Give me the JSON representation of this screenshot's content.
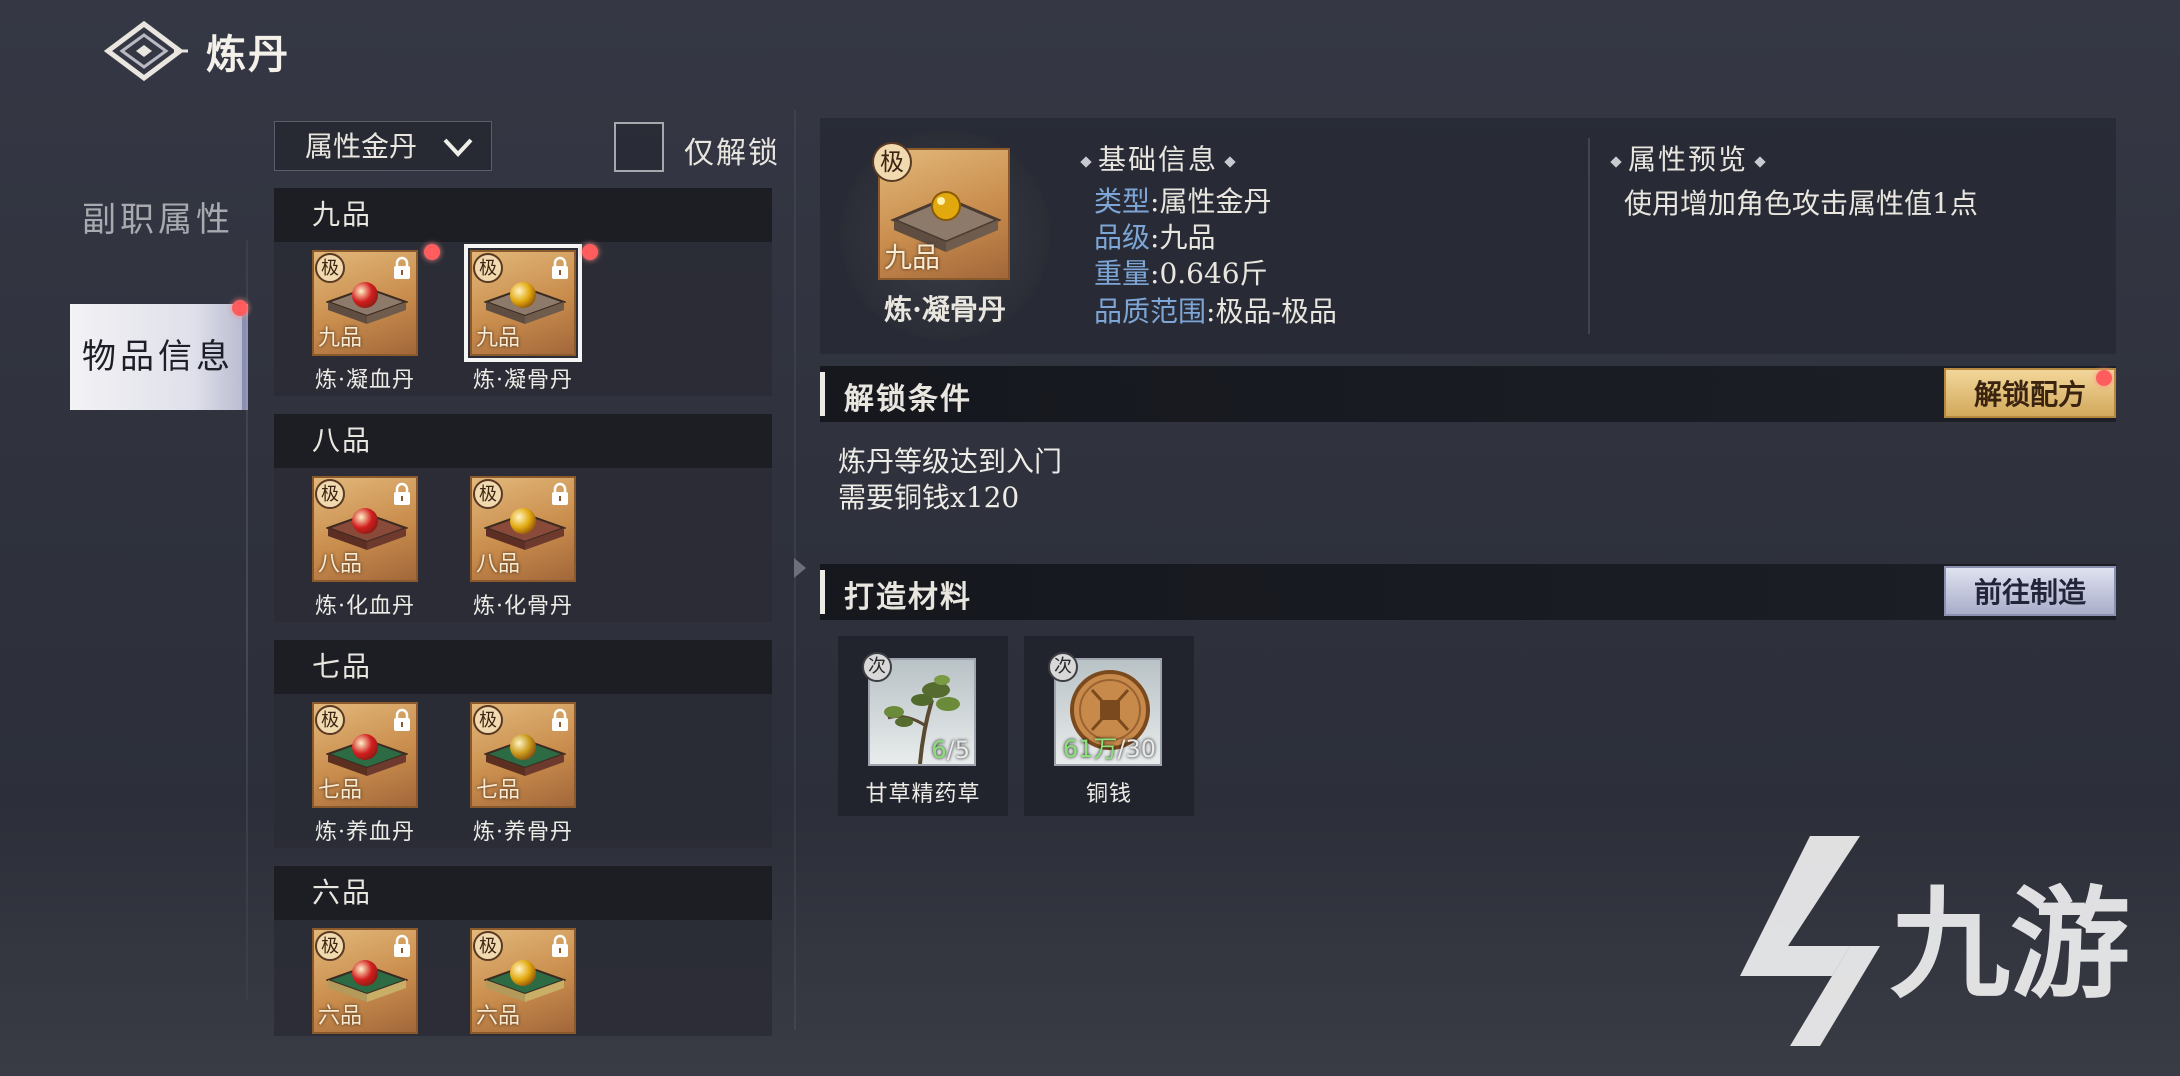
{
  "header": {
    "title": "炼丹",
    "back_icon": "diamond-back-icon"
  },
  "side_tabs": [
    {
      "label": "副职属性",
      "active": false
    },
    {
      "label": "物品信息",
      "active": true,
      "has_red_dot": true
    }
  ],
  "filter": {
    "dropdown_value": "属性金丹",
    "checkbox_label": "仅解锁",
    "checkbox_checked": false
  },
  "groups": [
    {
      "title": "九品",
      "items": [
        {
          "name": "炼·凝血丹",
          "grade": "极",
          "rank": "九品",
          "pill_color": "#d21f1f",
          "locked": true,
          "red_dot": true,
          "tray": "plain"
        },
        {
          "name": "炼·凝骨丹",
          "grade": "极",
          "rank": "九品",
          "pill_color": "#e2a90e",
          "locked": true,
          "red_dot": true,
          "selected": true,
          "tray": "plain"
        }
      ]
    },
    {
      "title": "八品",
      "items": [
        {
          "name": "炼·化血丹",
          "grade": "极",
          "rank": "八品",
          "pill_color": "#d21f1f",
          "locked": true,
          "tray": "red"
        },
        {
          "name": "炼·化骨丹",
          "grade": "极",
          "rank": "八品",
          "pill_color": "#e2a90e",
          "locked": true,
          "tray": "red"
        }
      ]
    },
    {
      "title": "七品",
      "items": [
        {
          "name": "炼·养血丹",
          "grade": "极",
          "rank": "七品",
          "pill_color": "#d21f1f",
          "locked": true,
          "tray": "green"
        },
        {
          "name": "炼·养骨丹",
          "grade": "极",
          "rank": "七品",
          "pill_color": "#c99a1a",
          "locked": true,
          "tray": "green"
        }
      ]
    },
    {
      "title": "六品",
      "items": [
        {
          "name": "",
          "grade": "极",
          "rank": "六品",
          "pill_color": "#d21f1f",
          "locked": true,
          "tray": "ornate"
        },
        {
          "name": "",
          "grade": "极",
          "rank": "六品",
          "pill_color": "#e2a90e",
          "locked": true,
          "tray": "ornate"
        }
      ]
    }
  ],
  "detail": {
    "name": "炼·凝骨丹",
    "grade": "极",
    "rank": "九品",
    "basic_title": "基础信息",
    "basic": [
      {
        "key": "类型",
        "value": "属性金丹"
      },
      {
        "key": "品级",
        "value": "九品"
      },
      {
        "key": "重量",
        "value": "0.646斤"
      },
      {
        "key": "品质范围",
        "value": "极品-极品"
      }
    ],
    "preview_title": "属性预览",
    "preview_text": "使用增加角色攻击属性值1点"
  },
  "unlock": {
    "title": "解锁条件",
    "button": "解锁配方",
    "conditions": [
      "炼丹等级达到入门",
      "需要铜钱x120"
    ]
  },
  "materials": {
    "title": "打造材料",
    "button": "前往制造",
    "items": [
      {
        "name": "甘草精药草",
        "grade": "次",
        "have": "6",
        "need": "5",
        "icon": "herb-icon"
      },
      {
        "name": "铜钱",
        "grade": "次",
        "have": "61万",
        "need": "30",
        "icon": "copper-coin-icon"
      }
    ]
  },
  "watermark": {
    "text": "九游"
  },
  "colors": {
    "accent_blue": "#7da6d6",
    "gold_button": "#d2a95c",
    "red_dot": "#ff5d5d",
    "have_green": "#8be07a"
  }
}
